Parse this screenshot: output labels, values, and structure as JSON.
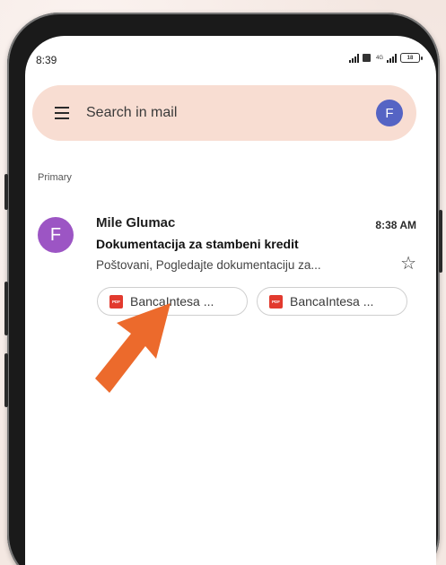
{
  "status_bar": {
    "time": "8:39",
    "signal_label": "4G",
    "battery_level": "18"
  },
  "search": {
    "placeholder": "Search in mail",
    "account_initial": "F"
  },
  "section": {
    "label": "Primary"
  },
  "email": {
    "avatar_initial": "F",
    "sender": "Mile Glumac",
    "time": "8:38 AM",
    "subject": "Dokumentacija za stambeni kredit",
    "snippet": "Poštovani, Pogledajte dokumentaciju za...",
    "attachments": [
      {
        "label": "BancaIntesa ...",
        "icon": "pdf-icon"
      },
      {
        "label": "BancaIntesa ...",
        "icon": "pdf-icon"
      }
    ]
  },
  "icons": {
    "menu": "menu-icon",
    "star": "star-icon",
    "pointer": "arrow-pointer-icon"
  },
  "colors": {
    "search_bg": "#f8ddd2",
    "account_avatar": "#5564c4",
    "sender_avatar": "#9c55c4",
    "pdf": "#e23a2e",
    "arrow": "#ec6a2c"
  }
}
